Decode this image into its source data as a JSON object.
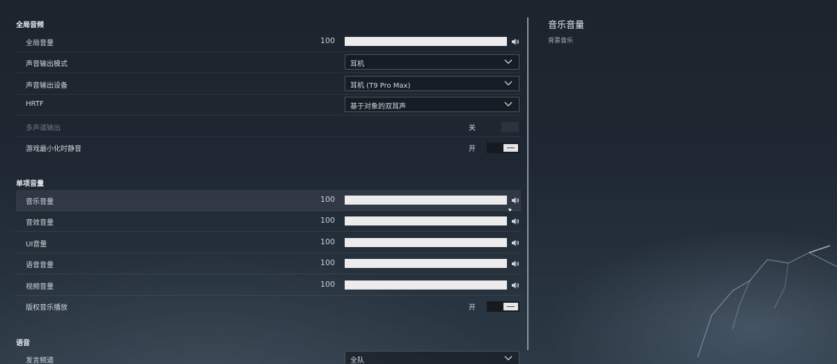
{
  "sections": {
    "global_audio": "全局音频",
    "individual_volume": "单项音量",
    "voice": "语音"
  },
  "global": {
    "master_volume": {
      "label": "全局音量",
      "value": "100",
      "level": 1.0
    },
    "output_mode": {
      "label": "声音输出模式",
      "selected": "耳机"
    },
    "output_device": {
      "label": "声音输出设备",
      "selected": "耳机 (T9 Pro Max)"
    },
    "hrtf": {
      "label": "HRTF",
      "selected": "基于对象的双耳声"
    },
    "multichannel": {
      "label": "多声道输出",
      "state": "关",
      "enabled": false
    },
    "mute_minimized": {
      "label": "游戏最小化时静音",
      "state": "开",
      "on": true
    }
  },
  "volumes": {
    "music": {
      "label": "音乐音量",
      "value": "100",
      "level": 1.0
    },
    "sfx": {
      "label": "音效音量",
      "value": "100",
      "level": 1.0
    },
    "ui": {
      "label": "UI音量",
      "value": "100",
      "level": 1.0
    },
    "voice": {
      "label": "语音音量",
      "value": "100",
      "level": 1.0
    },
    "video": {
      "label": "视频音量",
      "value": "100",
      "level": 1.0
    },
    "licensed_music": {
      "label": "版权音乐播放",
      "state": "开",
      "on": true
    }
  },
  "voice": {
    "channel": {
      "label": "发言频道",
      "selected": "全队"
    }
  },
  "detail": {
    "title": "音乐音量",
    "description": "背景音乐"
  },
  "icons": {
    "speaker": "speaker-icon",
    "chevron": "chevron-down-icon"
  },
  "colors": {
    "slider_fill": "#ececec",
    "toggle_knob": "#e6e6e6",
    "divider": "#8e969e"
  }
}
